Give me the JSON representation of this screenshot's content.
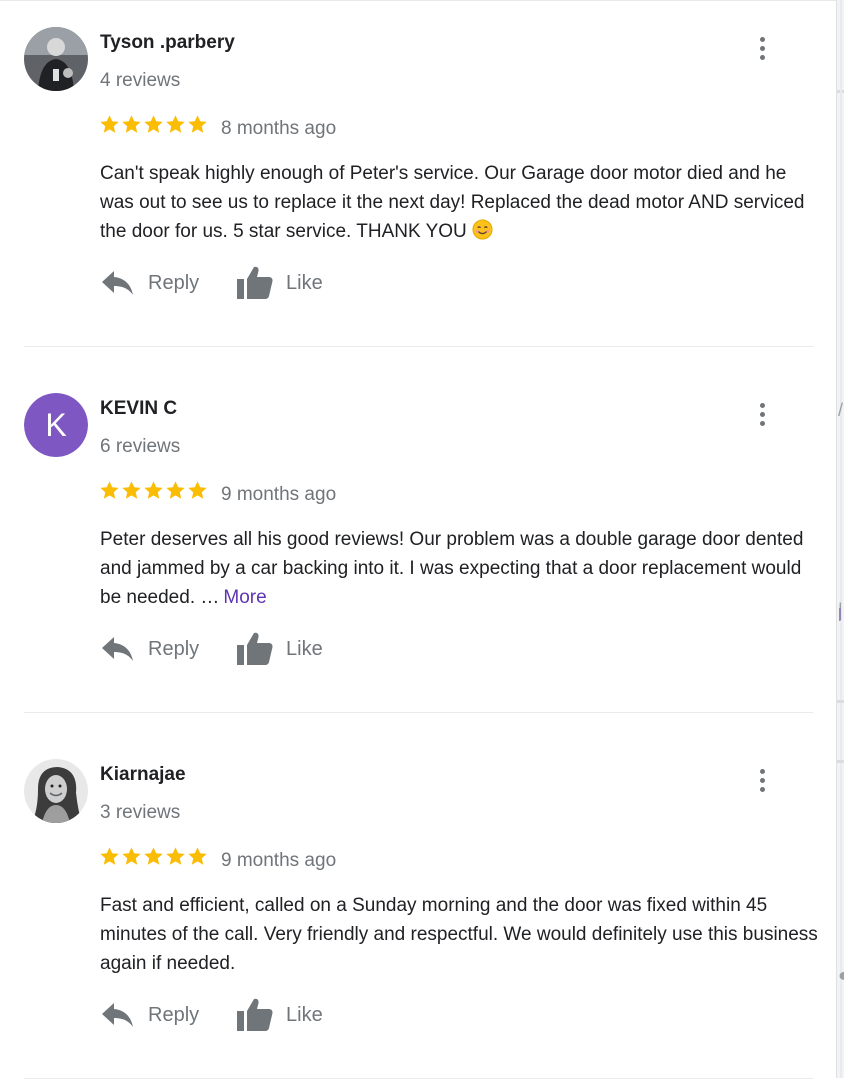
{
  "reviews": [
    {
      "author": "Tyson .parbery",
      "review_count": "4 reviews",
      "rating": 5,
      "date": "8 months ago",
      "text": "Can't speak highly enough of Peter's service. Our Garage door motor died and he was out to see us to replace it the next day! Replaced the dead motor AND serviced the door for us. 5 star service. THANK YOU",
      "emoji": "smiling-face-emoji",
      "more_label": "",
      "avatar": "photo",
      "reply_label": "Reply",
      "like_label": "Like"
    },
    {
      "author": "KEVIN C",
      "review_count": "6 reviews",
      "rating": 5,
      "date": "9 months ago",
      "text": "Peter deserves all his good reviews! Our problem was a double garage door dented and jammed by a car backing into it. I was expecting that a door replacement would be needed. …",
      "more_label": "More",
      "avatar": "letter",
      "avatar_letter": "K",
      "reply_label": "Reply",
      "like_label": "Like"
    },
    {
      "author": "Kiarnajae",
      "review_count": "3 reviews",
      "rating": 5,
      "date": "9 months ago",
      "text": "Fast and efficient, called on a Sunday morning and the door was fixed within 45 minutes of the call. Very friendly and respectful. We would definitely use this business again if needed.",
      "more_label": "",
      "avatar": "photo",
      "reply_label": "Reply",
      "like_label": "Like"
    }
  ],
  "icons": {
    "star": "star-icon",
    "reply": "reply-arrow-icon",
    "like": "thumbs-up-icon",
    "menu": "more-vertical-icon"
  },
  "colors": {
    "star": "#fbbc04",
    "secondary_text": "#70757a",
    "primary_text": "#202124",
    "link": "#5e35b1",
    "avatar_purple": "#7e57c2",
    "divider": "#e8eaed"
  }
}
